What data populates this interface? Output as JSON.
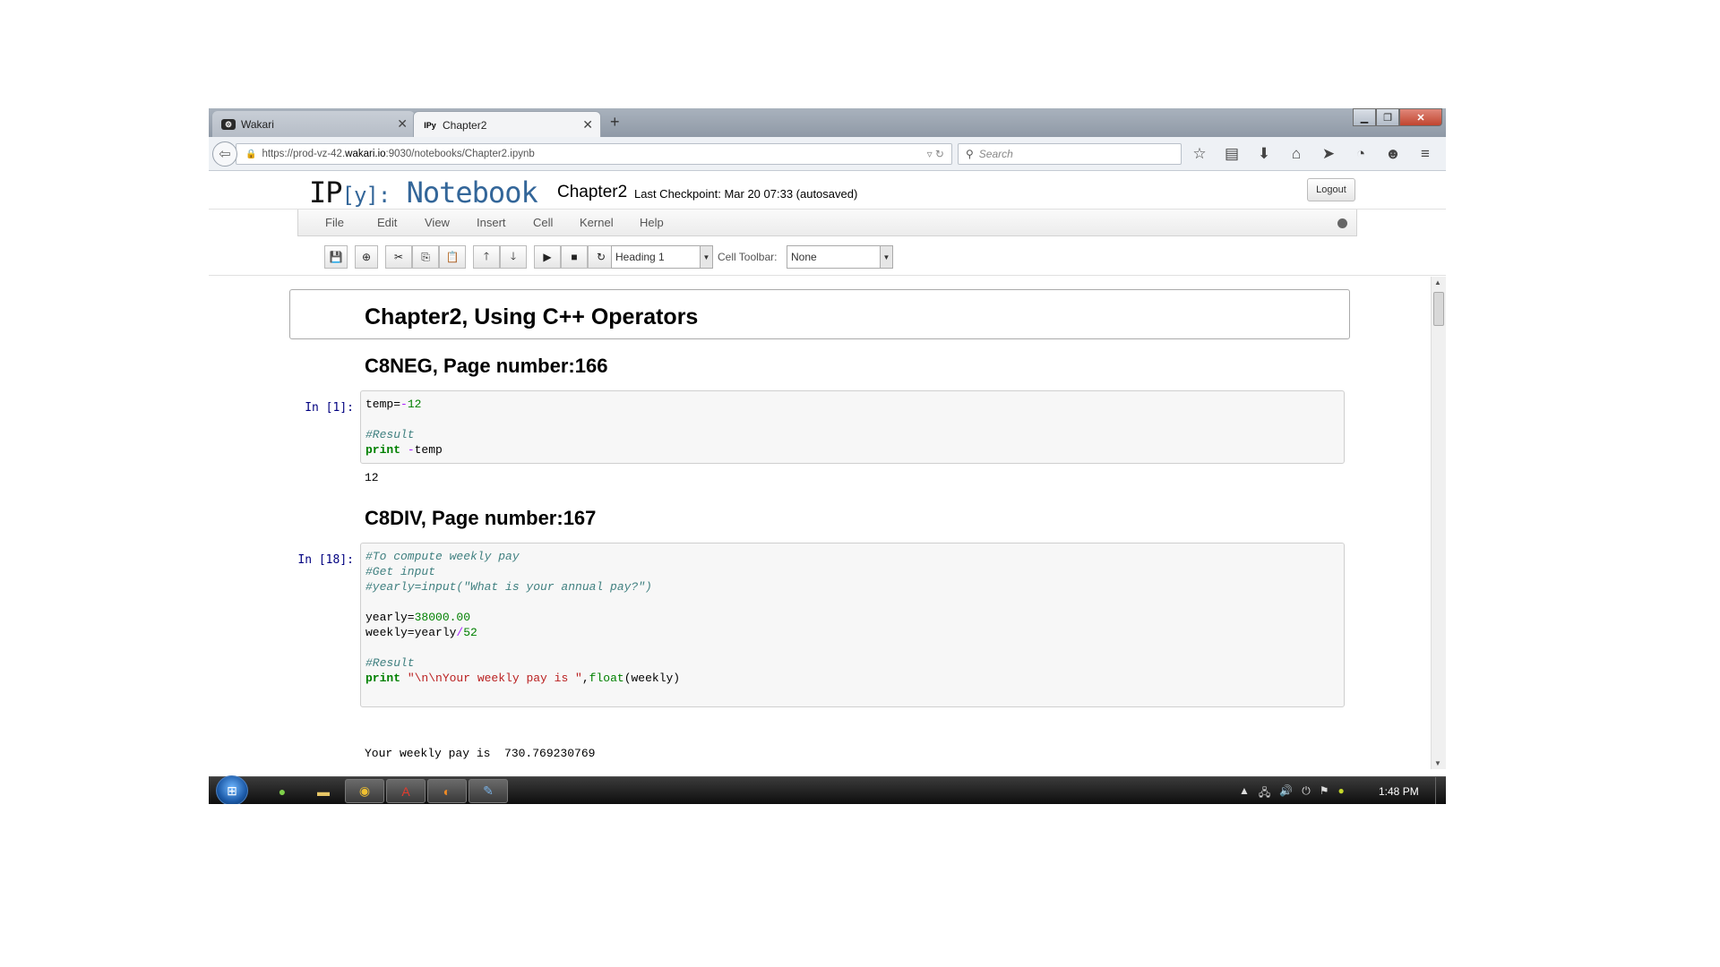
{
  "browser": {
    "tabs": [
      {
        "label": "Wakari",
        "favicon": "wakari-icon",
        "favicon_text": "⚙"
      },
      {
        "label": "Chapter2",
        "favicon": "ipython-icon",
        "favicon_text": "IPy"
      }
    ],
    "new_tab": "+",
    "url_prefix": "https://prod-vz-42.",
    "url_host": "wakari.io",
    "url_suffix": ":9030/notebooks/Chapter2.ipynb",
    "search_placeholder": "Search"
  },
  "notebook": {
    "logo_ip": "IP",
    "logo_y": "[y]:",
    "logo_notebook": "Notebook",
    "name": "Chapter2",
    "checkpoint": "Last Checkpoint: Mar 20 07:33 (autosaved)",
    "logout": "Logout",
    "menus": [
      "File",
      "Edit",
      "View",
      "Insert",
      "Cell",
      "Kernel",
      "Help"
    ],
    "cell_type": "Heading 1",
    "cell_toolbar_label": "Cell Toolbar:",
    "cell_toolbar_value": "None"
  },
  "cells": {
    "h1": "Chapter2, Using C++ Operators",
    "h2_a": "C8NEG, Page number:166",
    "prompt_a": "In [1]:",
    "code_a": {
      "l1_a": "temp=",
      "l1_b": "-",
      "l1_c": "12",
      "l3": "#Result",
      "l4_kw": "print",
      "l4_op": " -",
      "l4_rest": "temp"
    },
    "out_a": "12",
    "h2_b": "C8DIV, Page number:167",
    "prompt_b": "In [18]:",
    "code_b": {
      "l1": "#To compute weekly pay",
      "l2": "#Get input",
      "l3": "#yearly=input(\"What is your annual pay?\")",
      "l5_a": "yearly=",
      "l5_b": "38000.00",
      "l6_a": "weekly=yearly",
      "l6_b": "/",
      "l6_c": "52",
      "l8": "#Result",
      "l9_kw": "print",
      "l9_str": " \"\\n\\nYour weekly pay is \"",
      "l9_comma": ",",
      "l9_bi": "float",
      "l9_rest": "(weekly)"
    },
    "out_b": "Your weekly pay is  730.769230769"
  },
  "taskbar": {
    "clock": "1:48 PM"
  }
}
